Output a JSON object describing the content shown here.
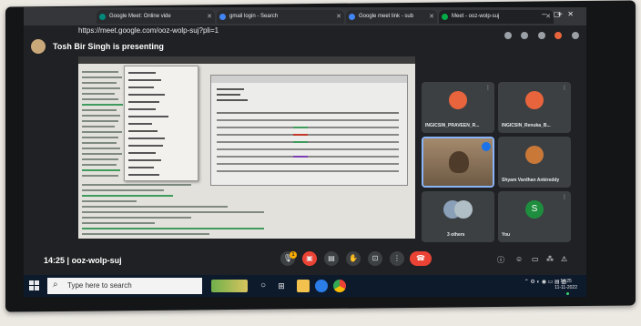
{
  "browser": {
    "tabs": [
      {
        "title": "Google Meet: Online vide",
        "active": false
      },
      {
        "title": "gmail login - Search",
        "active": false
      },
      {
        "title": "Google meet link - sub",
        "active": false
      },
      {
        "title": "Meet - ooz-wolp-suj",
        "active": true
      }
    ],
    "url": "https://meet.google.com/ooz-wolp-suj?pli=1"
  },
  "meet": {
    "presenter_text": "Tosh Bir Singh is presenting",
    "participants": [
      {
        "name": "INGICSIN_PRAVEEN_R...",
        "avatar_color": "#e8643c"
      },
      {
        "name": "INGICSIN_Renuka_B...",
        "avatar_color": "#e8643c"
      },
      {
        "name": "Shyam Vardhan Ankireddy",
        "avatar_color": "#c97838"
      },
      {
        "name": "3 others",
        "avatar_color": "#8aa0b8"
      },
      {
        "name": "You",
        "avatar_color": "#1e8e3e",
        "initial": "S"
      }
    ],
    "time": "14:25",
    "meeting_code": "ooz-wolp-suj",
    "mic_badge": "1"
  },
  "taskbar": {
    "search_placeholder": "Type here to search",
    "clock_time": "14:25",
    "clock_date": "11-11-2022"
  },
  "colors": {
    "end_call": "#ea4335",
    "taskbar": "#0d1a2c",
    "meet_bg": "#202124"
  }
}
